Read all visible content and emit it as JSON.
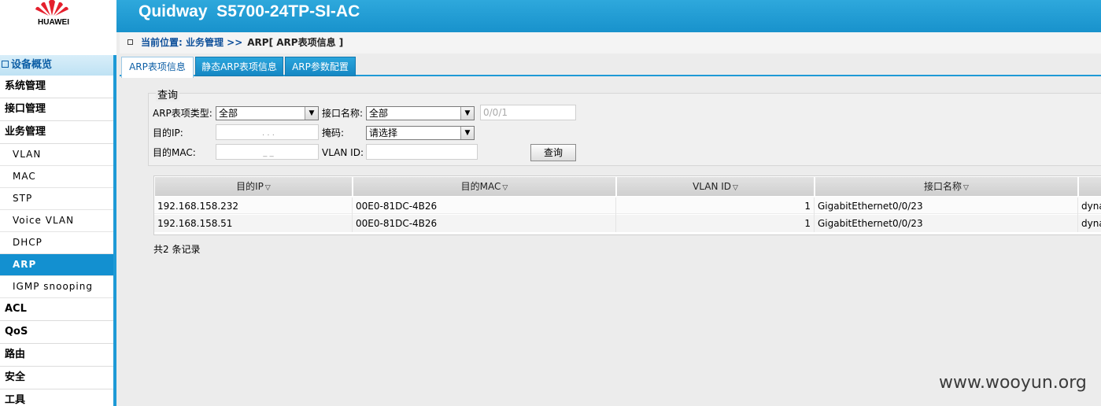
{
  "brand": {
    "logo_text": "HUAWEI",
    "device_title": "Quidway  S5700-24TP-SI-AC"
  },
  "breadcrumb": {
    "path": "当前位置: 业务管理 >>",
    "current": "ARP[ ARP表项信息 ]"
  },
  "sidebar": {
    "overview": "设备概览",
    "sections_top": [
      "系统管理",
      "接口管理",
      "业务管理"
    ],
    "sub_items": [
      {
        "label": "VLAN",
        "active": false
      },
      {
        "label": "MAC",
        "active": false
      },
      {
        "label": "STP",
        "active": false
      },
      {
        "label": "Voice VLAN",
        "active": false
      },
      {
        "label": "DHCP",
        "active": false
      },
      {
        "label": "ARP",
        "active": true
      },
      {
        "label": "IGMP snooping",
        "active": false
      }
    ],
    "sections_bottom": [
      "ACL",
      "QoS",
      "路由",
      "安全",
      "工具"
    ]
  },
  "tabs": [
    {
      "label": "ARP表项信息",
      "active": true
    },
    {
      "label": "静态ARP表项信息",
      "active": false
    },
    {
      "label": "ARP参数配置",
      "active": false
    }
  ],
  "query": {
    "legend": "查询",
    "arp_type_label": "ARP表项类型:",
    "arp_type_value": "全部",
    "iface_label": "接口名称:",
    "iface_value": "全部",
    "iface_number_placeholder": "0/0/1",
    "dest_ip_label": "目的IP:",
    "dest_ip_dots": ".       .       .",
    "mask_label": "掩码:",
    "mask_value": "请选择",
    "dest_mac_label": "目的MAC:",
    "dest_mac_dashes": "_           _",
    "vlan_label": "VLAN ID:",
    "vlan_value": "",
    "search_button": "查询"
  },
  "table": {
    "headers": [
      "目的IP",
      "目的MAC",
      "VLAN ID",
      "接口名称",
      ""
    ],
    "rows": [
      [
        "192.168.158.232",
        "00E0-81DC-4B26",
        "1",
        "GigabitEthernet0/0/23",
        "dyna"
      ],
      [
        "192.168.158.51",
        "00E0-81DC-4B26",
        "1",
        "GigabitEthernet0/0/23",
        "dyna"
      ]
    ],
    "total_text": "共2 条记录"
  },
  "watermark": "www.wooyun.org",
  "colors": {
    "header_blue": "#1e9ad6",
    "active_nav": "#1390d0",
    "logo_red": "#e4202d"
  }
}
